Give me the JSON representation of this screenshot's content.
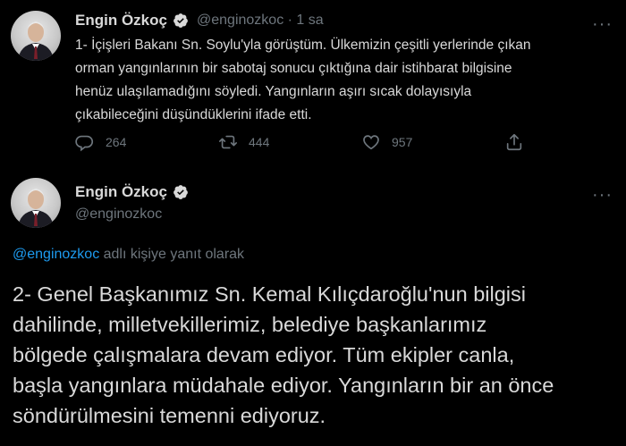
{
  "tweet1": {
    "name": "Engin Özkoç",
    "handle_time": "@enginozkoc · 1 sa",
    "text": "1- İçişleri Bakanı Sn. Soylu'yla görüştüm. Ülkemizin çeşitli yerlerinde çıkan\norman yangınlarının bir sabotaj sonucu çıktığına dair istihbarat bilgisine\nhenüz ulaşılamadığını söyledi. Yangınların aşırı sıcak dolayısıyla\nçıkabileceğini düşündüklerini ifade etti.",
    "replies": "264",
    "retweets": "444",
    "likes": "957",
    "more": "···"
  },
  "tweet2": {
    "name": "Engin Özkoç",
    "handle": "@enginozkoc",
    "more": "···",
    "reply_mention": "@enginozkoc",
    "reply_suffix": " adlı kişiye yanıt olarak",
    "text": "2- Genel Başkanımız Sn. Kemal Kılıçdaroğlu'nun bilgisi\ndahilinde, milletvekillerimiz, belediye başkanlarımız\nbölgede çalışmalara devam ediyor. Tüm ekipler canla,\nbaşla yangınlara müdahale ediyor. Yangınların bir an önce\nsöndürülmesini temenni ediyoruz."
  },
  "colors": {
    "background": "#000000",
    "text": "#d9d9d9",
    "muted": "#6e767d",
    "accent": "#1d9bf0"
  },
  "icons": [
    "avatar",
    "verified-badge-icon",
    "more-icon",
    "reply-icon",
    "retweet-icon",
    "like-icon",
    "share-icon"
  ]
}
